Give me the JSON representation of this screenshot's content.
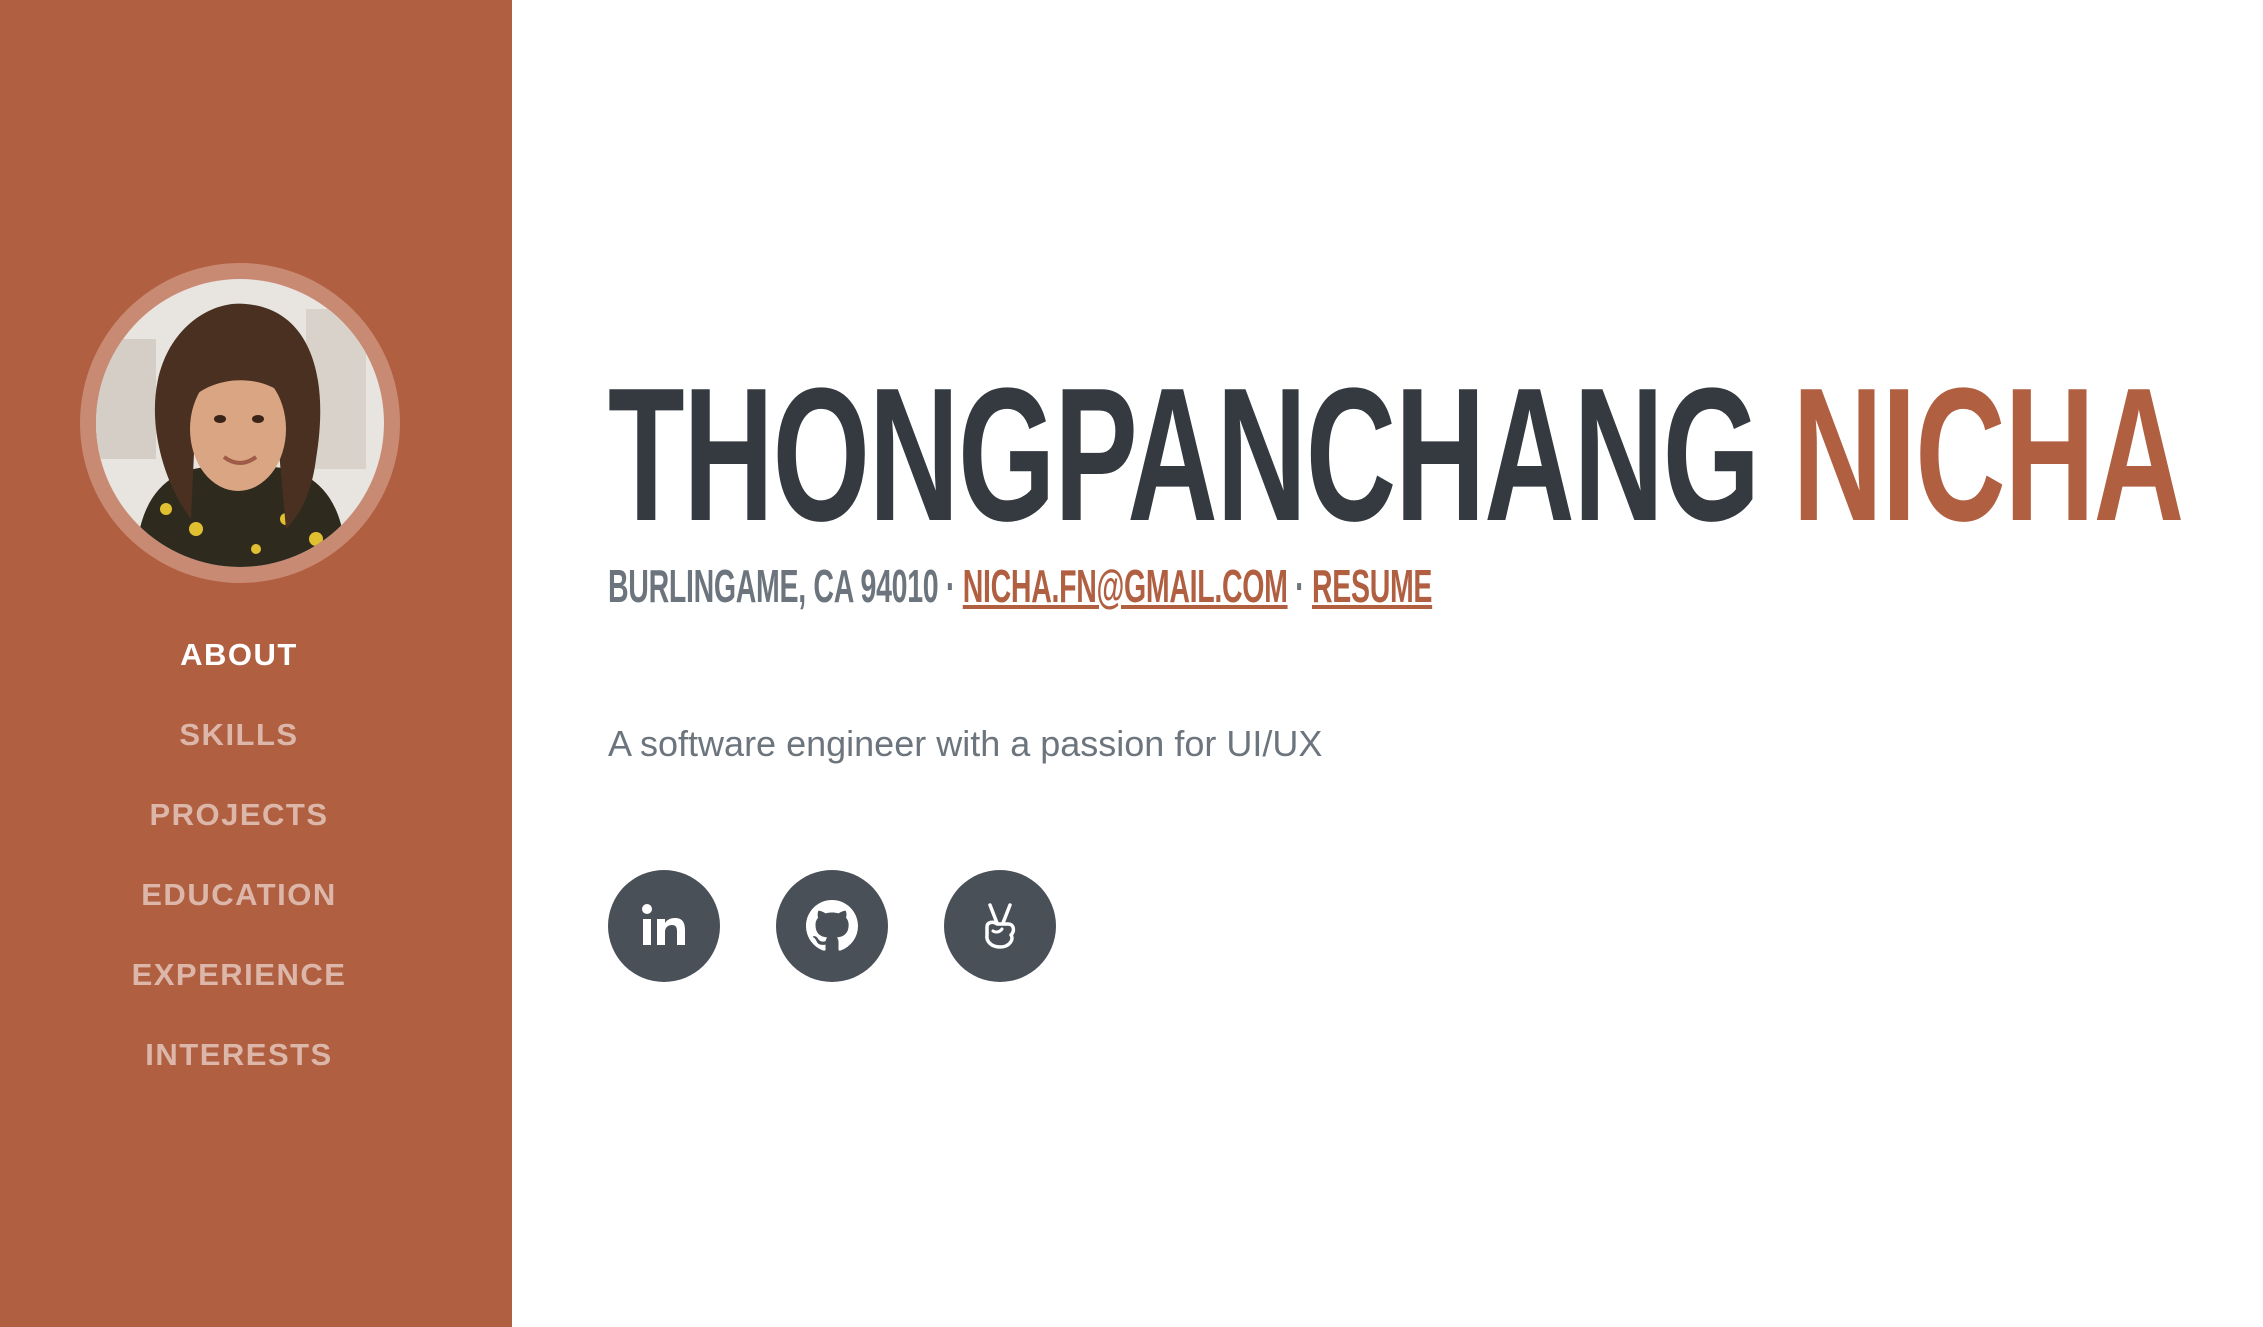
{
  "sidebar": {
    "avatar_alt": "Profile photo",
    "nav": [
      {
        "label": "ABOUT",
        "active": true
      },
      {
        "label": "SKILLS",
        "active": false
      },
      {
        "label": "PROJECTS",
        "active": false
      },
      {
        "label": "EDUCATION",
        "active": false
      },
      {
        "label": "EXPERIENCE",
        "active": false
      },
      {
        "label": "INTERESTS",
        "active": false
      }
    ]
  },
  "header": {
    "first_name": "THONGPANCHANG",
    "last_name": "NICHA",
    "location": "BURLINGAME, CA 94010",
    "separator": "·",
    "email": "NICHA.FN@GMAIL.COM",
    "resume": "RESUME"
  },
  "tagline": "A software engineer with a passion for UI/UX",
  "socials": [
    {
      "icon": "linkedin-icon"
    },
    {
      "icon": "github-icon"
    },
    {
      "icon": "angellist-icon"
    }
  ],
  "colors": {
    "accent": "#b15f41",
    "heading": "#343a40",
    "muted": "#6c757d",
    "social_bg": "#495057"
  }
}
